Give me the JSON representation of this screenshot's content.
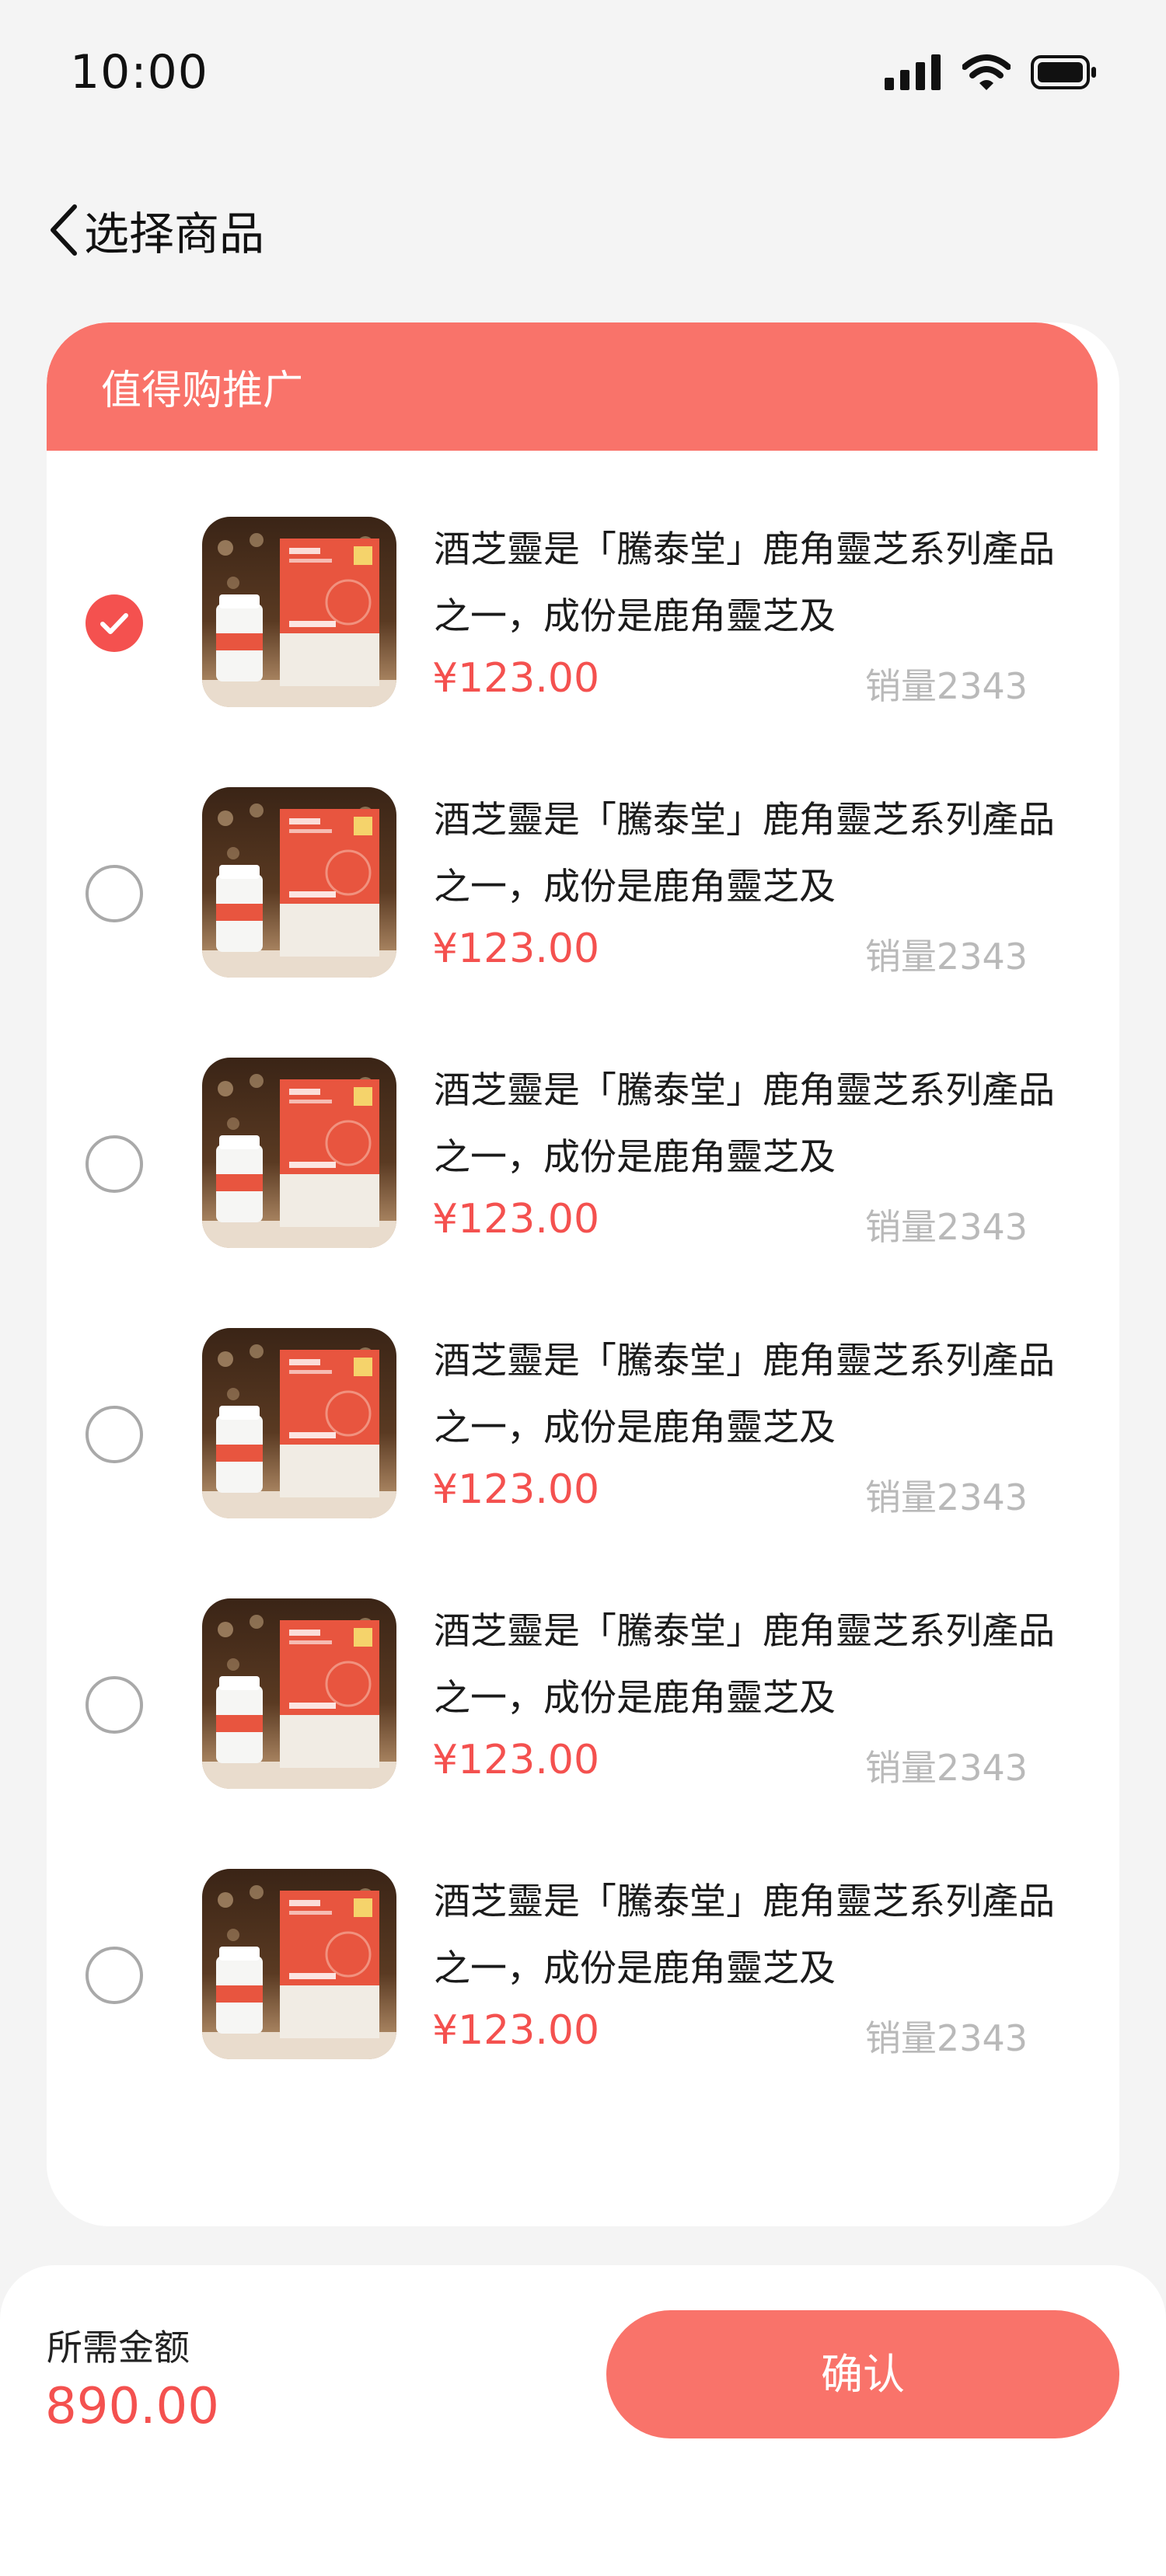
{
  "status_bar": {
    "time": "10:00"
  },
  "nav": {
    "title": "选择商品"
  },
  "section": {
    "title": "值得购推广"
  },
  "products": [
    {
      "title": "酒芝靈是「騰泰堂」鹿角靈芝系列產品之一，成份是鹿角靈芝及",
      "price": "¥123.00",
      "sales": "销量2343",
      "selected": true
    },
    {
      "title": "酒芝靈是「騰泰堂」鹿角靈芝系列產品之一，成份是鹿角靈芝及",
      "price": "¥123.00",
      "sales": "销量2343",
      "selected": false
    },
    {
      "title": "酒芝靈是「騰泰堂」鹿角靈芝系列產品之一，成份是鹿角靈芝及",
      "price": "¥123.00",
      "sales": "销量2343",
      "selected": false
    },
    {
      "title": "酒芝靈是「騰泰堂」鹿角靈芝系列產品之一，成份是鹿角靈芝及",
      "price": "¥123.00",
      "sales": "销量2343",
      "selected": false
    },
    {
      "title": "酒芝靈是「騰泰堂」鹿角靈芝系列產品之一，成份是鹿角靈芝及",
      "price": "¥123.00",
      "sales": "销量2343",
      "selected": false
    },
    {
      "title": "酒芝靈是「騰泰堂」鹿角靈芝系列產品之一，成份是鹿角靈芝及",
      "price": "¥123.00",
      "sales": "销量2343",
      "selected": false
    }
  ],
  "footer": {
    "total_label": "所需金额",
    "total_value": "890.00",
    "confirm_label": "确认"
  },
  "colors": {
    "accent": "#f9736a",
    "price": "#f4514f",
    "muted": "#b9b9b9"
  },
  "icons": [
    "signal-icon",
    "wifi-icon",
    "battery-icon",
    "back-chevron-icon",
    "checkmark-icon"
  ]
}
